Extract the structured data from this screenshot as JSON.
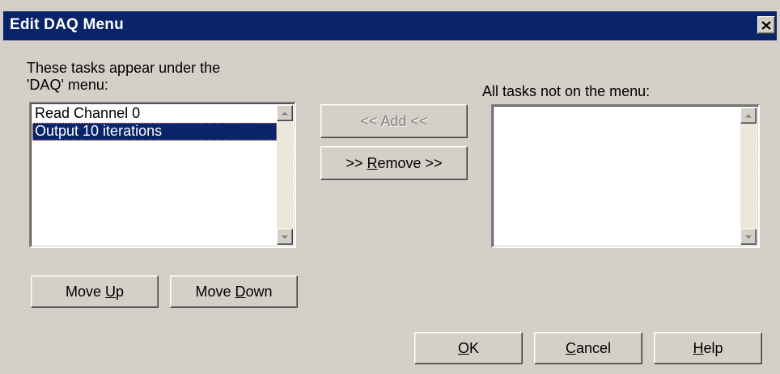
{
  "window": {
    "title": "Edit DAQ Menu"
  },
  "left_panel": {
    "label_line1": "These tasks appear under the",
    "label_line2": "'DAQ' menu:",
    "items": [
      {
        "label": "Read Channel 0",
        "selected": false
      },
      {
        "label": "Output 10 iterations",
        "selected": true
      }
    ]
  },
  "right_panel": {
    "label": "All tasks not on the menu:",
    "items": []
  },
  "buttons": {
    "add": {
      "label": "<< Add <<",
      "enabled": false
    },
    "remove": {
      "before": ">> ",
      "key": "R",
      "after": "emove >>"
    },
    "move_up": {
      "before": "Move ",
      "key": "U",
      "after": "p"
    },
    "move_down": {
      "before": "Move ",
      "key": "D",
      "after": "own"
    },
    "ok": {
      "before": "",
      "key": "O",
      "after": "K"
    },
    "cancel": {
      "before": "",
      "key": "C",
      "after": "ancel"
    },
    "help": {
      "before": "",
      "key": "H",
      "after": "elp"
    }
  },
  "icons": {
    "close": "close-icon",
    "scroll_up": "arrow-up-icon",
    "scroll_down": "arrow-down-icon"
  },
  "colors": {
    "titlebar": "#0a246a",
    "face": "#d4d0c8",
    "selection": "#0a246a",
    "disabled_text": "#808080"
  }
}
